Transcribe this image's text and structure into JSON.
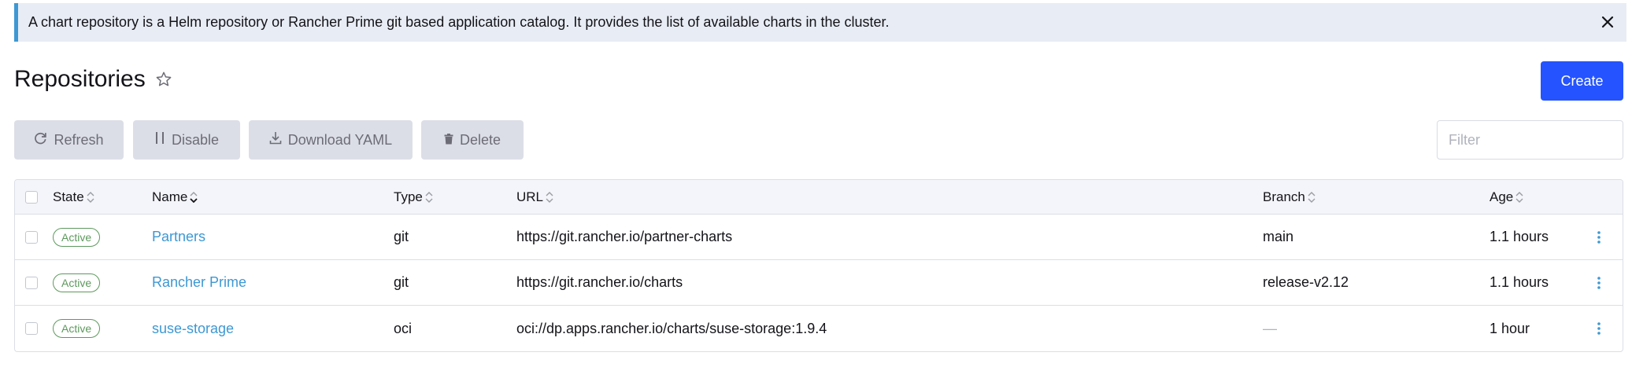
{
  "banner": {
    "text": "A chart repository is a Helm repository or Rancher Prime git based application catalog. It provides the list of available charts in the cluster.",
    "close_icon": "close-icon"
  },
  "header": {
    "title": "Repositories",
    "favorite_icon": "star-outline-icon",
    "create_label": "Create"
  },
  "toolbar": {
    "refresh_label": "Refresh",
    "disable_label": "Disable",
    "download_yaml_label": "Download YAML",
    "delete_label": "Delete",
    "filter_placeholder": "Filter"
  },
  "table": {
    "columns": {
      "state": "State",
      "name": "Name",
      "type": "Type",
      "url": "URL",
      "branch": "Branch",
      "age": "Age"
    },
    "rows": [
      {
        "state": "Active",
        "name": "Partners",
        "type": "git",
        "url": "https://git.rancher.io/partner-charts",
        "branch": "main",
        "age": "1.1 hours"
      },
      {
        "state": "Active",
        "name": "Rancher Prime",
        "type": "git",
        "url": "https://git.rancher.io/charts",
        "branch": "release-v2.12",
        "age": "1.1 hours"
      },
      {
        "state": "Active",
        "name": "suse-storage",
        "type": "oci",
        "url": "oci://dp.apps.rancher.io/charts/suse-storage:1.9.4",
        "branch": "—",
        "age": "1 hour"
      }
    ]
  },
  "colors": {
    "primary": "#2453ff",
    "link": "#3d98d3",
    "active_badge": "#5d995d",
    "banner_bg": "#e8ecf4",
    "banner_accent": "#3d98d3"
  }
}
